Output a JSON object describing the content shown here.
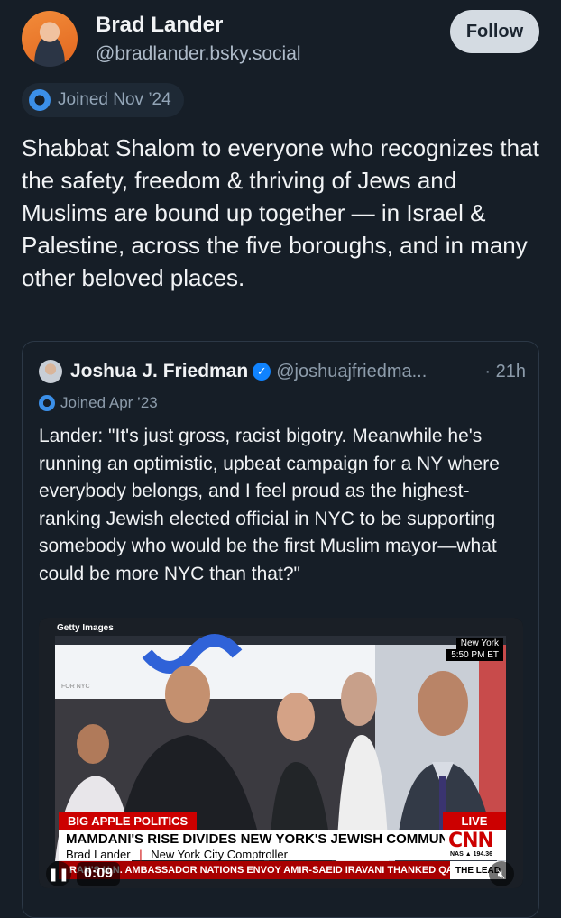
{
  "author": {
    "name": "Brad Lander",
    "handle": "@bradlander.bsky.social",
    "joined": "Joined Nov ’24"
  },
  "follow_button": "Follow",
  "post": {
    "text": "Shabbat Shalom to everyone who recognizes that the safety, freedom & thriving of Jews and Muslims are bound up together — in Israel & Palestine, across the five boroughs, and in many other beloved places."
  },
  "quoted_post": {
    "name": "Joshua J. Friedman",
    "handle": "@joshuajfriedma...",
    "time": "· 21h",
    "joined": "Joined Apr ’23",
    "text": "Lander: \"It's just gross, racist bigotry. Meanwhile he's running an optimistic, upbeat campaign for a NY where everybody belongs, and I feel proud as the highest-ranking Jewish elected official in NYC to be supporting somebody who would be the first Muslim mayor—what could be more NYC than that?\""
  },
  "video": {
    "watermark": "Getty Images",
    "location": "New York",
    "clock": "5:50 PM ET",
    "banner_left": "FOR NYC",
    "chyron_tag": "BIG APPLE POLITICS",
    "live_label": "LIVE",
    "headline": "MAMDANI'S RISE DIVIDES NEW YORK'S JEWISH COMMUNITY",
    "guest_name": "Brad Lander",
    "guest_title": "New York City Comptroller",
    "network": "CNN",
    "market": "NAS ▲ 194.36",
    "ticker": "RAN'S U.N. AMBASSADOR NATIONS ENVOY AMIR-SAEID IRAVANI THANKED QATAR FOR ITS ROLE IN",
    "ticker_label": "THE LEAD",
    "elapsed": "0:09"
  },
  "colors": {
    "background": "#161e27",
    "verified": "#1083fe",
    "cnn_red": "#cc0000"
  }
}
